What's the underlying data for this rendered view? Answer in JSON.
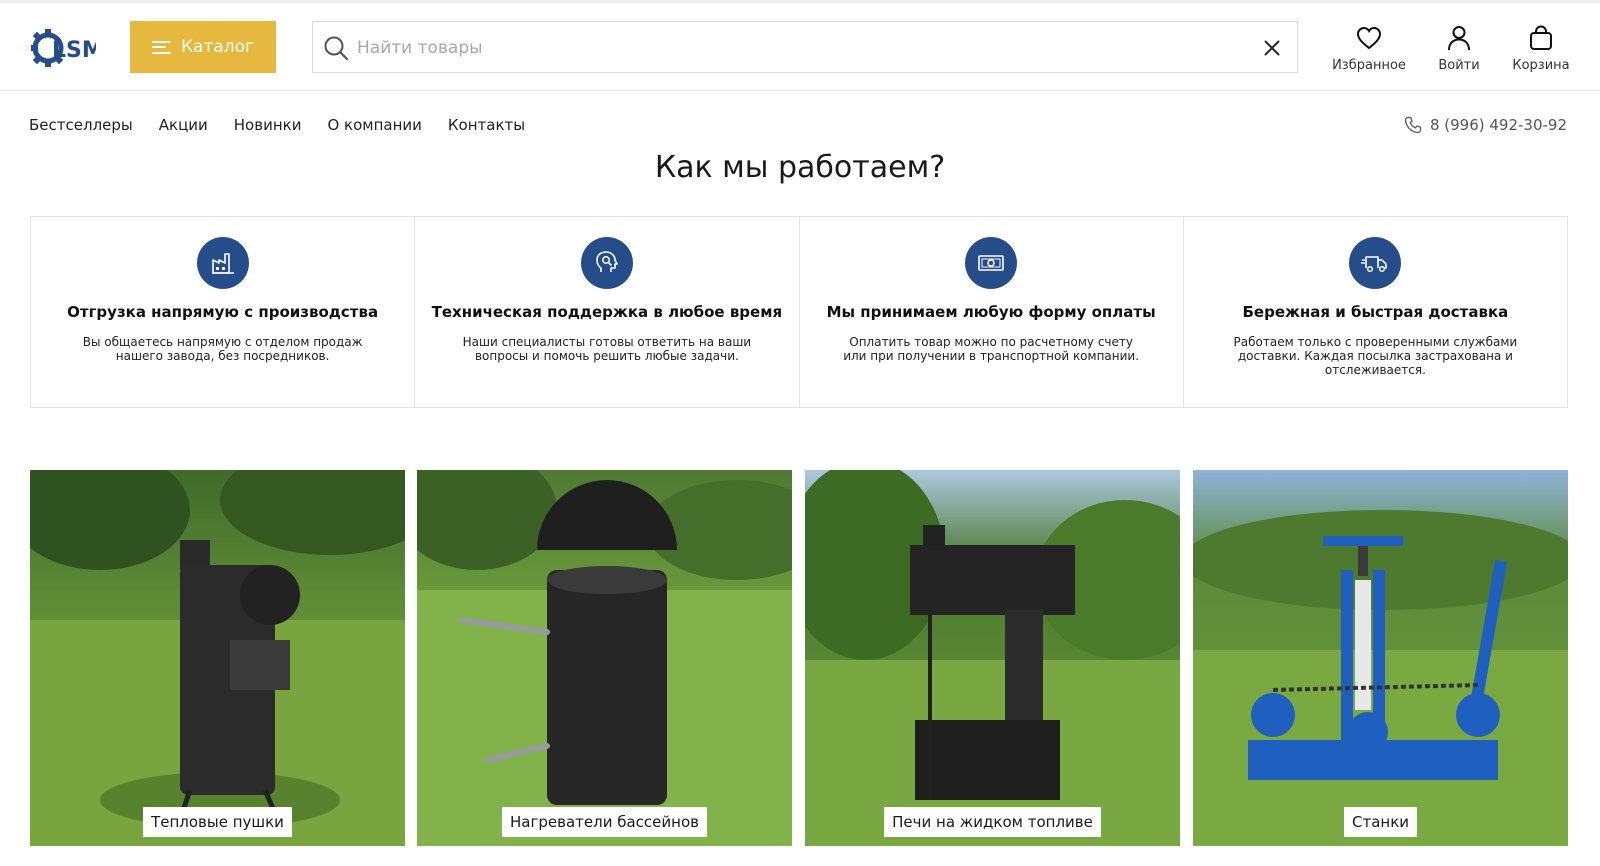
{
  "header": {
    "logo_text": "LSM",
    "catalog_label": "Каталог",
    "search_placeholder": "Найти товары",
    "search_value": "",
    "actions": [
      {
        "label": "Избранное",
        "icon": "heart-icon"
      },
      {
        "label": "Войти",
        "icon": "user-icon"
      },
      {
        "label": "Корзина",
        "icon": "bag-icon"
      }
    ]
  },
  "nav": {
    "items": [
      "Бестселлеры",
      "Акции",
      "Новинки",
      "О компании",
      "Контакты"
    ],
    "phone": "8 (996) 492-30-92"
  },
  "how": {
    "title": "Как мы работаем?",
    "features": [
      {
        "icon": "factory-icon",
        "title": "Отгрузка напрямую с производства",
        "text": "Вы общаетесь напрямую с отделом продаж нашего завода, без посредников."
      },
      {
        "icon": "support-icon",
        "title": "Техническая поддержка в любое время",
        "text": "Наши специалисты готовы ответить на ваши вопросы и помочь решить любые задачи."
      },
      {
        "icon": "cash-icon",
        "title": "Мы принимаем любую форму оплаты",
        "text": "Оплатить товар можно по расчетному счету или при получении в транспортной компании."
      },
      {
        "icon": "truck-icon",
        "title": "Бережная и быстрая доставка",
        "text": "Работаем только с проверенными службами доставки. Каждая посылка застрахована и отслеживается."
      }
    ]
  },
  "categories": [
    {
      "label": "Тепловые пушки"
    },
    {
      "label": "Нагреватели бассейнов"
    },
    {
      "label": "Печи на жидком топливе"
    },
    {
      "label": "Станки"
    }
  ],
  "colors": {
    "accent": "#e6b93e",
    "brand_blue": "#244d8a",
    "border": "#e3e3e3"
  }
}
